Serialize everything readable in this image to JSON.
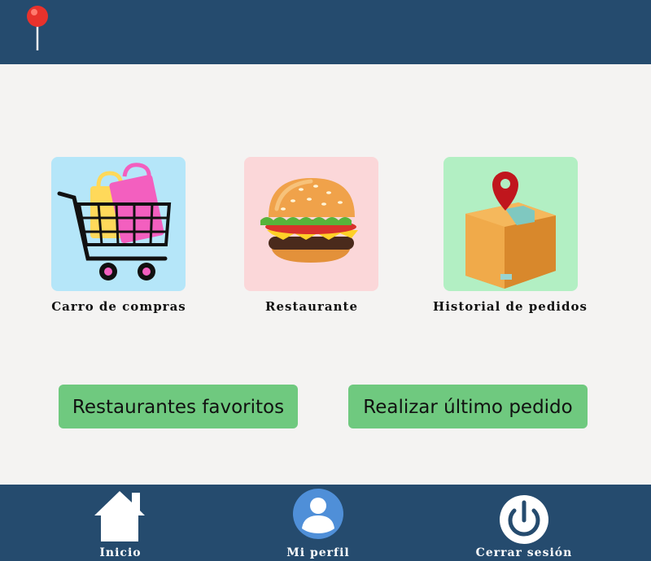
{
  "header": {
    "icon": "map-pin-icon"
  },
  "tiles": [
    {
      "label": "Carro de compras",
      "icon": "shopping-cart-icon",
      "bg": "#b5e6f9"
    },
    {
      "label": "Restaurante",
      "icon": "burger-icon",
      "bg": "#fbd7d9"
    },
    {
      "label": "Historial de pedidos",
      "icon": "package-location-icon",
      "bg": "#b2efc3"
    }
  ],
  "buttons": {
    "favorites": "Restaurantes favoritos",
    "last_order": "Realizar último pedido"
  },
  "nav": [
    {
      "label": "Inicio",
      "icon": "home-icon"
    },
    {
      "label": "Mi perfil",
      "icon": "user-icon"
    },
    {
      "label": "Cerrar sesión",
      "icon": "power-icon"
    }
  ],
  "colors": {
    "bar": "#254b6e",
    "button": "#6fc97f",
    "background": "#f4f3f2"
  }
}
